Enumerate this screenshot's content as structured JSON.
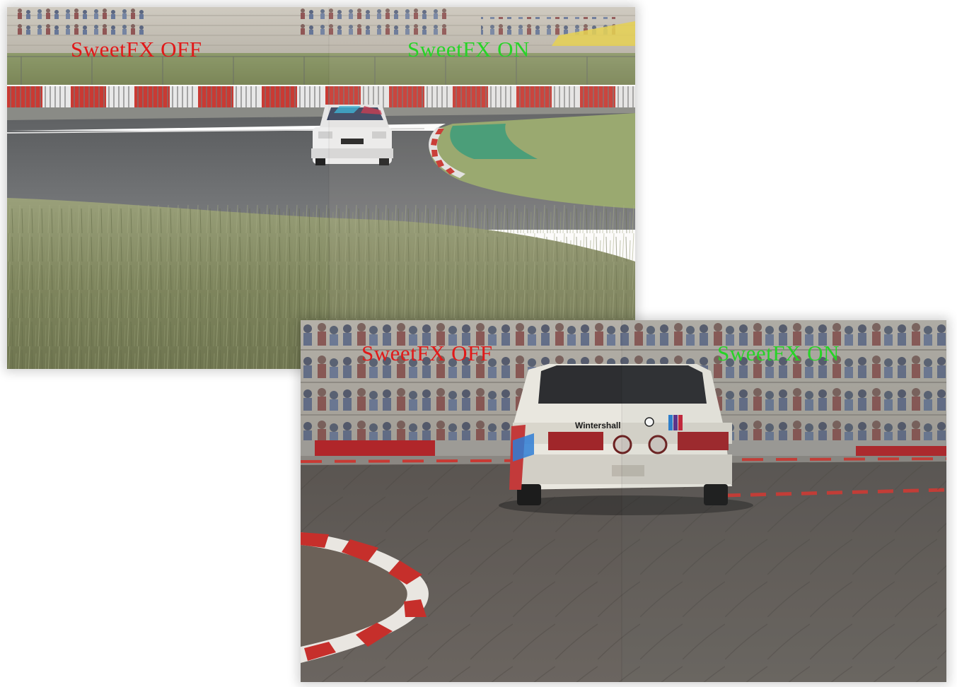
{
  "shots": [
    {
      "label_off": "SweetFX OFF",
      "label_on": "SweetFX ON"
    },
    {
      "label_off": "SweetFX OFF",
      "label_on": "SweetFX ON",
      "car_sponsor_text": "Wintershall"
    }
  ],
  "colors": {
    "label_off": "#e11919",
    "label_on": "#27d327"
  }
}
